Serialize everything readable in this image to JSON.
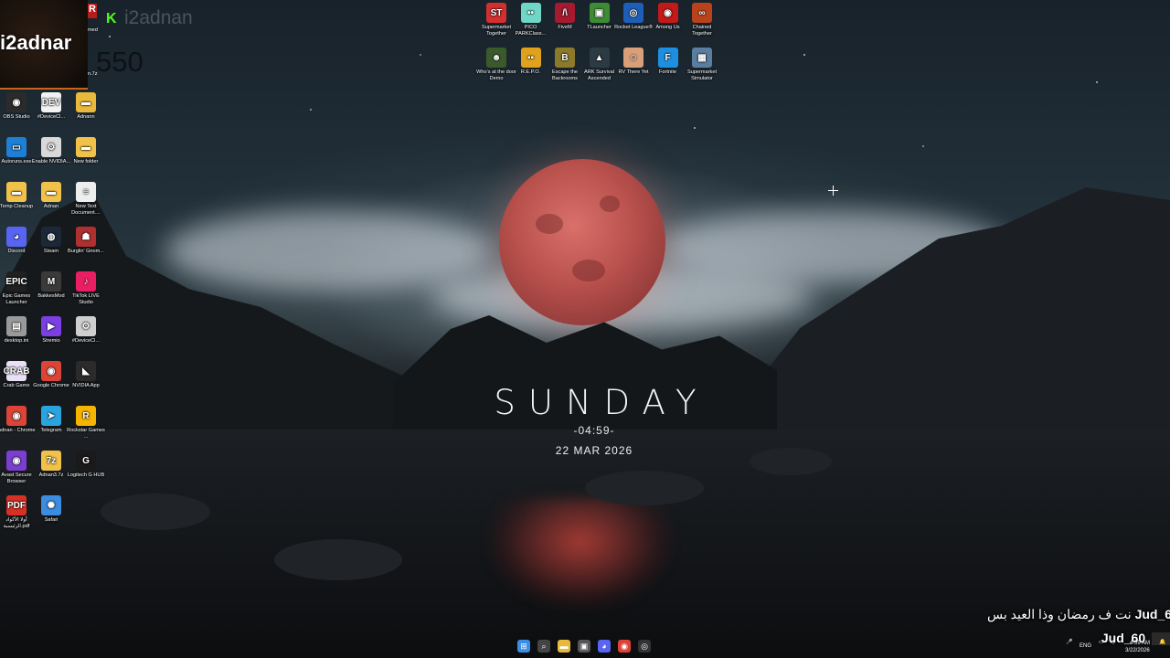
{
  "overlay": {
    "streamer_name": "i2adnar",
    "ghost_name": "i2adnan",
    "ghost_count": "550",
    "partial_left_label": "med",
    "partial_left_label2": "n.7z",
    "logo_letter": "R",
    "kick_letter": "K"
  },
  "clock": {
    "day": "SUNDAY",
    "time": "-04:59-",
    "date": "22 MAR 2026"
  },
  "top_icons": [
    {
      "label": "Supermarket Together",
      "glyph": "ST",
      "color": "#d32f2f",
      "icon": "supermarket-together-icon"
    },
    {
      "label": "PICO PARKClass...",
      "glyph": "••",
      "color": "#6fd6c8",
      "icon": "pico-park-icon"
    },
    {
      "label": "FiveM",
      "glyph": "/\\",
      "color": "#a61a2f",
      "icon": "fivem-icon"
    },
    {
      "label": "TLauncher",
      "glyph": "▣",
      "color": "#3e8b35",
      "icon": "tlauncher-icon"
    },
    {
      "label": "Rocket League®",
      "glyph": "◎",
      "color": "#1d5fb8",
      "icon": "rocket-league-icon"
    },
    {
      "label": "Among Us",
      "glyph": "◉",
      "color": "#c41919",
      "icon": "among-us-icon"
    },
    {
      "label": "Chained Together",
      "glyph": "∞",
      "color": "#b8421c",
      "icon": "chained-together-icon"
    },
    {
      "label": "Who's at the door Demo",
      "glyph": "☻",
      "color": "#3b5a2b",
      "icon": "whos-at-the-door-icon"
    },
    {
      "label": "R.E.P.O.",
      "glyph": "▪▪",
      "color": "#e0a21c",
      "icon": "repo-icon"
    },
    {
      "label": "Escape the Backrooms",
      "glyph": "B",
      "color": "#8c7a2a",
      "icon": "escape-backrooms-icon"
    },
    {
      "label": "ARK Survival Ascended",
      "glyph": "▲",
      "color": "#2c3a44",
      "icon": "ark-icon"
    },
    {
      "label": "RV There Yet",
      "glyph": "☺",
      "color": "#d89f7a",
      "icon": "rv-there-yet-icon"
    },
    {
      "label": "Fortnite",
      "glyph": "F",
      "color": "#1e8fe0",
      "icon": "fortnite-icon"
    },
    {
      "label": "Supermarket Simulator",
      "glyph": "▦",
      "color": "#5a7ea0",
      "icon": "supermarket-simulator-icon"
    }
  ],
  "left_icons": [
    {
      "label": "OBS Studio",
      "glyph": "◉",
      "color": "#2b2b2b",
      "icon": "obs-studio-icon"
    },
    {
      "label": "#DeviceCl...",
      "glyph": "DEV",
      "color": "#f2f2f2",
      "icon": "device-cleanup-icon"
    },
    {
      "label": "Adnann",
      "glyph": "▬",
      "color": "#e8b93a",
      "icon": "folder-icon"
    },
    {
      "label": "Autoruns.exe",
      "glyph": "▭",
      "color": "#1f7fd4",
      "icon": "autoruns-icon"
    },
    {
      "label": "Enable NVIDIA...",
      "glyph": "⚙",
      "color": "#d9d9d9",
      "icon": "settings-file-icon"
    },
    {
      "label": "New folder",
      "glyph": "▬",
      "color": "#f0c24a",
      "icon": "folder-icon"
    },
    {
      "label": "Temp Cleanup",
      "glyph": "▬",
      "color": "#f0c24a",
      "icon": "folder-icon"
    },
    {
      "label": "Adnan",
      "glyph": "▬",
      "color": "#f0c24a",
      "icon": "folder-icon"
    },
    {
      "label": "New Text Document....",
      "glyph": "≡",
      "color": "#eeeeee",
      "icon": "text-document-icon"
    },
    {
      "label": "Discord",
      "glyph": "◕",
      "color": "#5865f2",
      "icon": "discord-icon"
    },
    {
      "label": "Steam",
      "glyph": "◍",
      "color": "#1b2838",
      "icon": "steam-icon"
    },
    {
      "label": "Burglin' Gnom...",
      "glyph": "☗",
      "color": "#b03030",
      "icon": "burglin-gnomes-icon"
    },
    {
      "label": "Epic Games Launcher",
      "glyph": "EPIC",
      "color": "#202020",
      "icon": "epic-games-icon"
    },
    {
      "label": "BakkesMod",
      "glyph": "M",
      "color": "#3a3a3a",
      "icon": "bakkesmod-icon"
    },
    {
      "label": "TikTok LIVE Studio",
      "glyph": "♪",
      "color": "#e91e63",
      "icon": "tiktok-live-icon"
    },
    {
      "label": "desktop.ini",
      "glyph": "▤",
      "color": "#9a9a9a",
      "icon": "ini-file-icon"
    },
    {
      "label": "Stremio",
      "glyph": "▶",
      "color": "#7b3fe4",
      "icon": "stremio-icon"
    },
    {
      "label": "#DeviceCl...",
      "glyph": "⚙",
      "color": "#cfcfcf",
      "icon": "device-cleanup-shortcut-icon"
    },
    {
      "label": "Crab Game",
      "glyph": "CRAB",
      "color": "#e9e0f6",
      "icon": "crab-game-icon"
    },
    {
      "label": "Google Chrome",
      "glyph": "◉",
      "color": "#db4437",
      "icon": "chrome-icon"
    },
    {
      "label": "NVIDIA App",
      "glyph": "◣",
      "color": "#2b2b2b",
      "icon": "nvidia-app-icon"
    },
    {
      "label": "Adnan - Chrome",
      "glyph": "◉",
      "color": "#db4437",
      "icon": "chrome-profile-icon"
    },
    {
      "label": "Telegram",
      "glyph": "➤",
      "color": "#2aa3de",
      "icon": "telegram-icon"
    },
    {
      "label": "Rockstar Games ...",
      "glyph": "R",
      "color": "#f5b400",
      "icon": "rockstar-games-icon"
    },
    {
      "label": "Avast Secure Browser",
      "glyph": "◉",
      "color": "#7a3fd0",
      "icon": "avast-browser-icon"
    },
    {
      "label": "Adnan3.7z",
      "glyph": "7z",
      "color": "#f0c24a",
      "icon": "archive-icon"
    },
    {
      "label": "Logitech G HUB",
      "glyph": "G",
      "color": "#1a1a1a",
      "icon": "logitech-ghub-icon"
    },
    {
      "label": "أولا الأكواد الرئيسية.pdf",
      "glyph": "PDF",
      "color": "#d93025",
      "icon": "pdf-icon"
    },
    {
      "label": "Safari",
      "glyph": "✺",
      "color": "#3c8ce0",
      "icon": "safari-icon"
    }
  ],
  "chat": [
    {
      "user": "Jud_60",
      "message": "نت ف رمضان وذا العيد بس"
    },
    {
      "user": "Jud_60",
      "message": ""
    }
  ],
  "taskbar": {
    "icons": [
      {
        "name": "start-icon",
        "glyph": "⊞",
        "color": "#3b8ee6"
      },
      {
        "name": "search-icon",
        "glyph": "⌕",
        "color": "#444444"
      },
      {
        "name": "file-explorer-icon",
        "glyph": "▬",
        "color": "#e8b93a"
      },
      {
        "name": "store-icon",
        "glyph": "▣",
        "color": "#555555"
      },
      {
        "name": "discord-taskbar-icon",
        "glyph": "◕",
        "color": "#5865f2"
      },
      {
        "name": "chrome-taskbar-icon",
        "glyph": "◉",
        "color": "#db4437"
      },
      {
        "name": "obs-taskbar-icon",
        "glyph": "◎",
        "color": "#333333"
      }
    ],
    "language": "ENG",
    "time": "4:59 AM",
    "date": "3/22/2026"
  }
}
